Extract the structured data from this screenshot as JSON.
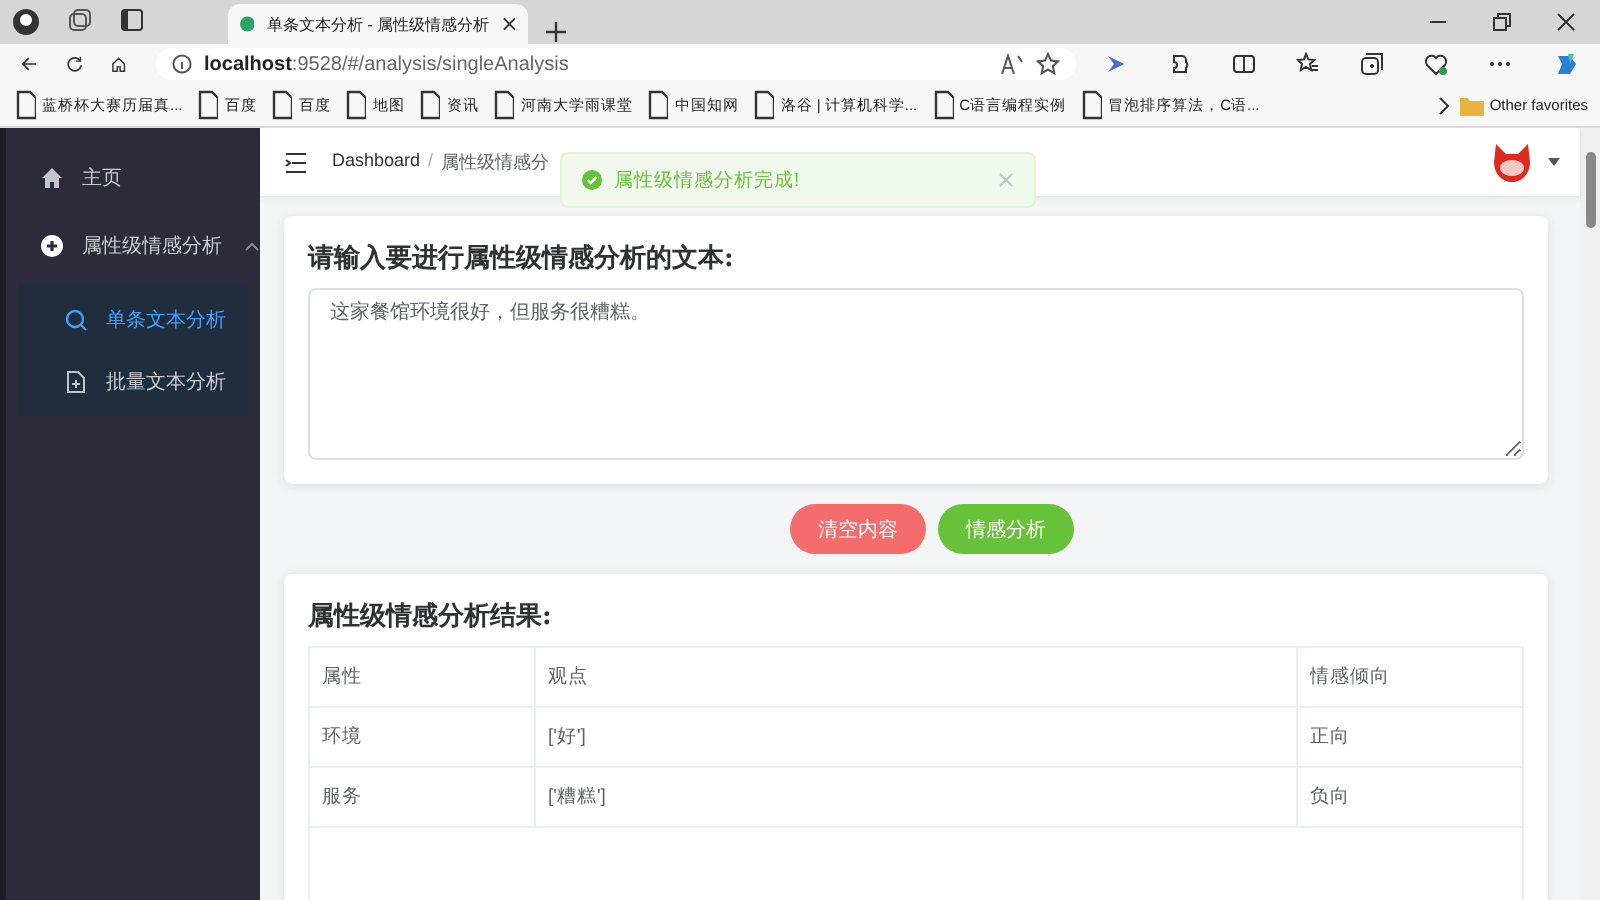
{
  "browser": {
    "tab_title": "单条文本分析 - 属性级情感分析",
    "address": {
      "host": "localhost",
      "path": ":9528/#/analysis/singleAnalysis"
    },
    "bookmarks": [
      "蓝桥杯大赛历届真...",
      "百度",
      "百度",
      "地图",
      "资讯",
      "河南大学雨课堂",
      "中国知网",
      "洛谷 | 计算机科学...",
      "C语言编程实例",
      "冒泡排序算法，C语..."
    ],
    "other_favorites": "Other favorites"
  },
  "sidebar": {
    "items": [
      {
        "label": "主页",
        "kind": "link",
        "selected": false
      },
      {
        "label": "属性级情感分析",
        "kind": "group",
        "expanded": true,
        "children": [
          {
            "label": "单条文本分析",
            "kind": "search",
            "selected": true
          },
          {
            "label": "批量文本分析",
            "kind": "file",
            "selected": false
          }
        ]
      }
    ]
  },
  "breadcrumb": {
    "separator": "/",
    "items": [
      "Dashboard",
      "属性级情感分"
    ]
  },
  "toast": {
    "message": "属性级情感分析完成!"
  },
  "input_card": {
    "title": "请输入要进行属性级情感分析的文本:",
    "value": "这家餐馆环境很好，但服务很糟糕。"
  },
  "buttons": [
    {
      "label": "清空内容",
      "kind": "danger"
    },
    {
      "label": "情感分析",
      "kind": "success"
    }
  ],
  "result_card": {
    "title": "属性级情感分析结果:",
    "table": {
      "columns": [
        "属性",
        "观点",
        "情感倾向"
      ],
      "rows": [
        [
          "环境",
          "['好']",
          "正向"
        ],
        [
          "服务",
          "['糟糕']",
          "负向"
        ]
      ]
    }
  }
}
